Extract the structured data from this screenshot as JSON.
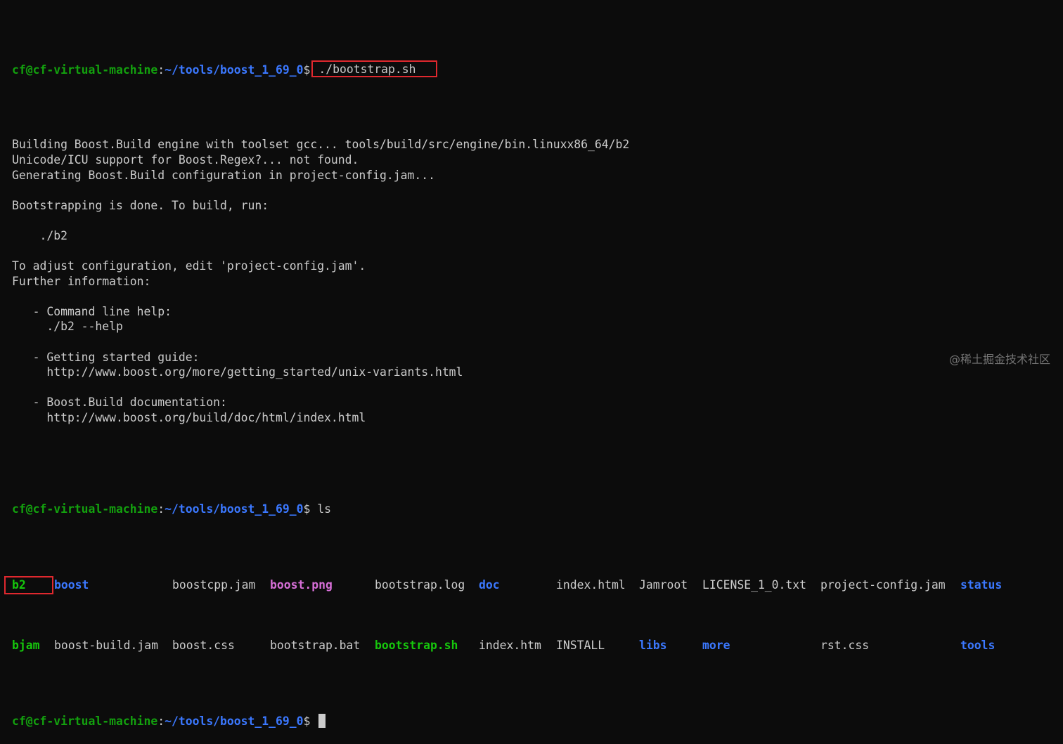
{
  "terminal": {
    "prompt_user": "cf@cf-virtual-machine",
    "prompt_colon": ":",
    "prompt_path": "~/tools/boost_1_69_0",
    "prompt_dollar": "$ ",
    "command1": "./bootstrap.sh",
    "output_lines": [
      "Building Boost.Build engine with toolset gcc... tools/build/src/engine/bin.linuxx86_64/b2",
      "Unicode/ICU support for Boost.Regex?... not found.",
      "Generating Boost.Build configuration in project-config.jam...",
      "",
      "Bootstrapping is done. To build, run:",
      "",
      "    ./b2",
      "",
      "To adjust configuration, edit 'project-config.jam'.",
      "Further information:",
      "",
      "   - Command line help:",
      "     ./b2 --help",
      "",
      "   - Getting started guide:",
      "     http://www.boost.org/more/getting_started/unix-variants.html",
      "",
      "   - Boost.Build documentation:",
      "     http://www.boost.org/build/doc/html/index.html",
      ""
    ],
    "command2": "ls",
    "ls_row1": [
      {
        "name": "b2",
        "type": "exec"
      },
      {
        "name": "boost",
        "type": "dir"
      },
      {
        "name": "boostcpp.jam",
        "type": "file"
      },
      {
        "name": "boost.png",
        "type": "img"
      },
      {
        "name": "bootstrap.log",
        "type": "file"
      },
      {
        "name": "doc",
        "type": "dir"
      },
      {
        "name": "index.html",
        "type": "file"
      },
      {
        "name": "Jamroot",
        "type": "file"
      },
      {
        "name": "LICENSE_1_0.txt",
        "type": "file"
      },
      {
        "name": "project-config.jam",
        "type": "file"
      },
      {
        "name": "status",
        "type": "dir"
      }
    ],
    "ls_row2": [
      {
        "name": "bjam",
        "type": "exec"
      },
      {
        "name": "boost-build.jam",
        "type": "file"
      },
      {
        "name": "boost.css",
        "type": "file"
      },
      {
        "name": "bootstrap.bat",
        "type": "file"
      },
      {
        "name": "bootstrap.sh",
        "type": "exec"
      },
      {
        "name": "index.htm",
        "type": "file"
      },
      {
        "name": "INSTALL",
        "type": "file"
      },
      {
        "name": "libs",
        "type": "dir"
      },
      {
        "name": "more",
        "type": "dir"
      },
      {
        "name": "",
        "type": "file"
      },
      {
        "name": "rst.css",
        "type": "file"
      },
      {
        "name": "tools",
        "type": "dir"
      }
    ]
  },
  "watermark": "@稀土掘金技术社区",
  "colors": {
    "background": "#0c0c0c",
    "prompt_user": "#13a10e",
    "prompt_path": "#3b78ff",
    "highlight_box": "#e0282e"
  }
}
